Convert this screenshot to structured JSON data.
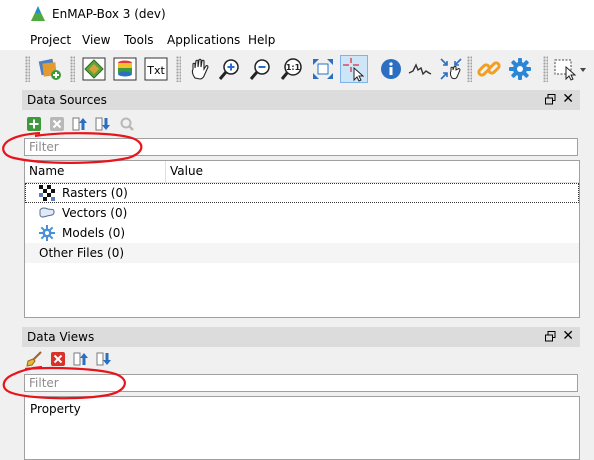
{
  "window": {
    "title": "EnMAP-Box 3 (dev)"
  },
  "menu": [
    "Project",
    "View",
    "Tools",
    "Applications",
    "Help"
  ],
  "toolbar": {
    "buttons": [
      "add-data-source-icon",
      "open-raster-map-icon",
      "open-spectral-library-icon",
      "open-text-view-icon",
      "pan-icon",
      "zoom-in-icon",
      "zoom-out-icon",
      "zoom-actual-size-icon",
      "zoom-full-extent-icon",
      "select-location-icon",
      "identify-icon",
      "spectral-profile-icon",
      "move-to-center-icon",
      "link-views-icon",
      "processing-tools-icon",
      "select-features-icon"
    ],
    "active": "select-location-icon"
  },
  "data_sources": {
    "title": "Data Sources",
    "filter_placeholder": "Filter",
    "columns": {
      "name": "Name",
      "value": "Value"
    },
    "items": [
      {
        "label": "Rasters (0)",
        "icon": "raster-icon"
      },
      {
        "label": "Vectors (0)",
        "icon": "vector-icon"
      },
      {
        "label": "Models (0)",
        "icon": "model-icon"
      },
      {
        "label": "Other Files (0)",
        "icon": ""
      }
    ]
  },
  "data_views": {
    "title": "Data Views",
    "filter_placeholder": "Filter",
    "property_label": "Property"
  },
  "colors": {
    "annotation": "#e8141c",
    "active_button": "#cde6f7",
    "panel_header": "#dcdcdc"
  }
}
